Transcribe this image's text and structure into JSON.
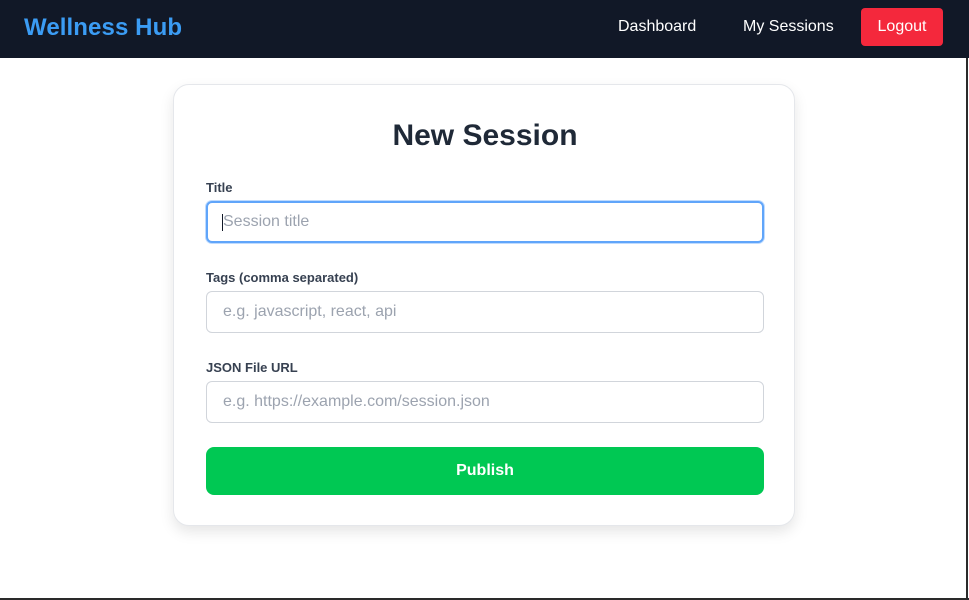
{
  "navbar": {
    "brand": "Wellness Hub",
    "links": [
      {
        "label": "Dashboard"
      },
      {
        "label": "My Sessions"
      }
    ],
    "logout_label": "Logout",
    "colors": {
      "background": "#111827",
      "brand": "#3b9cf4",
      "logout": "#f4283c"
    }
  },
  "form": {
    "title": "New Session",
    "fields": [
      {
        "label": "Title",
        "value": "",
        "placeholder": "Session title",
        "focused": true
      },
      {
        "label": "Tags (comma separated)",
        "value": "",
        "placeholder": "e.g. javascript, react, api"
      },
      {
        "label": "JSON File URL",
        "value": "",
        "placeholder": "e.g. https://example.com/session.json"
      }
    ],
    "submit_label": "Publish",
    "colors": {
      "submit": "#00c853",
      "focus_border": "#60a5fa"
    }
  }
}
